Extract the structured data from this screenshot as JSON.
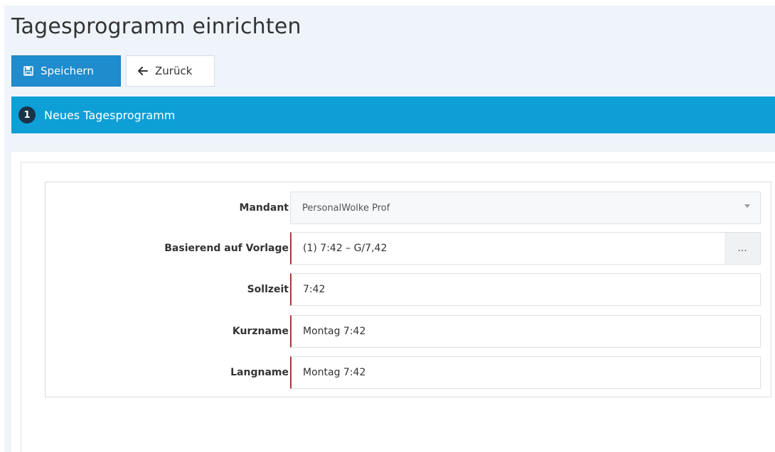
{
  "page": {
    "title": "Tagesprogramm einrichten"
  },
  "toolbar": {
    "save_label": "Speichern",
    "back_label": "Zurück",
    "save_icon": "floppy-disk-icon",
    "back_icon": "arrow-left-icon"
  },
  "step": {
    "number": "1",
    "label": "Neues Tagesprogramm"
  },
  "form": {
    "mandant": {
      "label": "Mandant",
      "value": "PersonalWolke Prof"
    },
    "vorlage": {
      "label": "Basierend auf Vorlage",
      "value": "(1) 7:42 – G/7,42",
      "button_label": "..."
    },
    "sollzeit": {
      "label": "Sollzeit",
      "value": "7:42"
    },
    "kurzname": {
      "label": "Kurzname",
      "value": "Montag 7:42"
    },
    "langname": {
      "label": "Langname",
      "value": "Montag 7:42"
    }
  },
  "colors": {
    "primary": "#1f8ccd",
    "step_bar": "#0e9fd6",
    "required_border": "#b03535"
  }
}
